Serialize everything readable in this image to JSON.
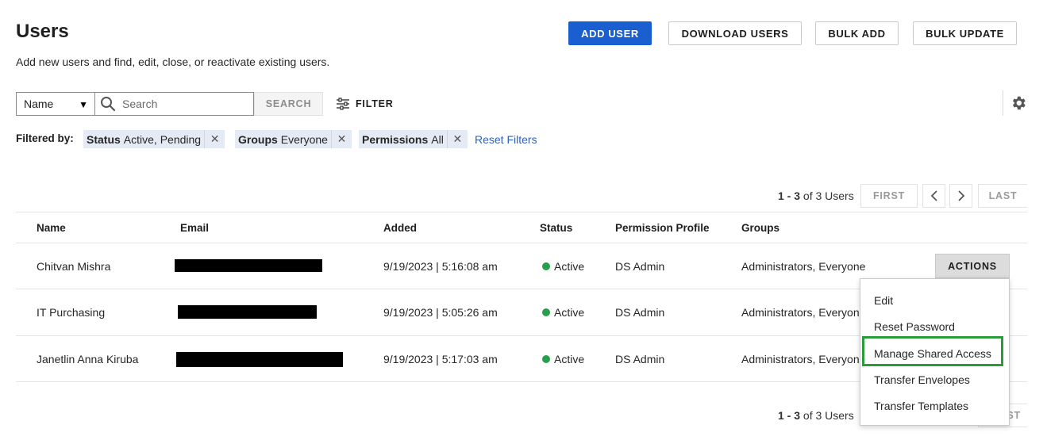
{
  "header": {
    "title": "Users",
    "subtitle": "Add new users and find, edit, close, or reactivate existing users."
  },
  "toolbar": {
    "add_user": "ADD USER",
    "download_users": "DOWNLOAD USERS",
    "bulk_add": "BULK ADD",
    "bulk_update": "BULK UPDATE"
  },
  "search": {
    "field_select": "Name",
    "placeholder": "Search",
    "button": "SEARCH",
    "filter": "FILTER"
  },
  "filters": {
    "label": "Filtered by:",
    "chips": [
      {
        "key": "Status",
        "value": "Active, Pending"
      },
      {
        "key": "Groups",
        "value": "Everyone"
      },
      {
        "key": "Permissions",
        "value": "All"
      }
    ],
    "reset": "Reset Filters"
  },
  "pagination": {
    "range": "1 - 3",
    "of_text": "of 3 Users",
    "first": "FIRST",
    "prev_icon": "chevron-left-icon",
    "next_icon": "chevron-right-icon",
    "last": "LAST"
  },
  "table": {
    "columns": [
      "Name",
      "Email",
      "Added",
      "Status",
      "Permission Profile",
      "Groups"
    ],
    "rows": [
      {
        "name": "Chitvan Mishra",
        "added": "9/19/2023 | 5:16:08 am",
        "status": "Active",
        "profile": "DS Admin",
        "groups": "Administrators, Everyone"
      },
      {
        "name": "IT Purchasing",
        "added": "9/19/2023 | 5:05:26 am",
        "status": "Active",
        "profile": "DS Admin",
        "groups": "Administrators, Everyon"
      },
      {
        "name": "Janetlin Anna Kiruba",
        "added": "9/19/2023 | 5:17:03 am",
        "status": "Active",
        "profile": "DS Admin",
        "groups": "Administrators, Everyon"
      }
    ],
    "actions_label": "ACTIONS"
  },
  "actions_menu": {
    "items": [
      "Edit",
      "Reset Password",
      "Manage Shared Access",
      "Transfer Envelopes",
      "Transfer Templates"
    ],
    "highlighted": "Manage Shared Access"
  },
  "bottom_pagination": {
    "range": "1 - 3",
    "of_text": "of 3 Users",
    "last_partial": "ST"
  },
  "colors": {
    "primary": "#1a5fd0",
    "status_active": "#27a04a",
    "chip_bg": "#e5ebf4",
    "link": "#2f62b8",
    "highlight": "#2a9d3a"
  },
  "icons": {
    "search": "search-icon",
    "filter": "sliders-icon",
    "settings": "gear-icon",
    "remove": "close-icon",
    "dropdown": "caret-down-icon"
  }
}
